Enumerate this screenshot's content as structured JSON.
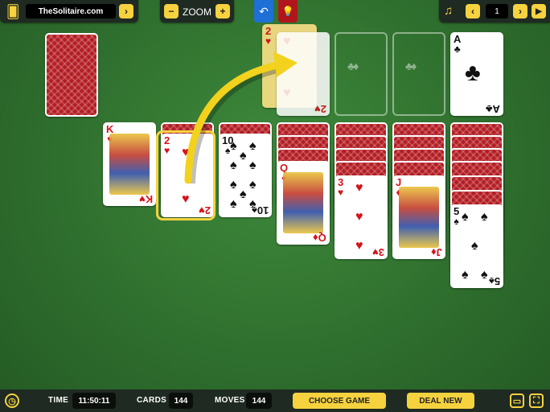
{
  "header": {
    "logo_text": "TheSolitaire.com",
    "forward_icon": "chevron-right-icon",
    "zoom_label": "ZOOM",
    "undo_icon": "undo-icon",
    "hint_icon": "lightbulb-icon",
    "music_icon": "music-icon",
    "page_number": "1"
  },
  "foundation": {
    "ace_rank": "A",
    "ace_suit": "♣",
    "empty_suits": "♣♦♥♠"
  },
  "hint_card": {
    "rank": "2",
    "suit": "♥"
  },
  "tableau": {
    "col1": {
      "rank": "K",
      "suit": "♥"
    },
    "col2": {
      "rank": "2",
      "suit": "♥"
    },
    "col3": {
      "rank": "10",
      "suit": "♠"
    },
    "col4": {
      "rank": "Q",
      "suit": "♦"
    },
    "col5": {
      "rank": "3",
      "suit": "♥"
    },
    "col6": {
      "rank": "J",
      "suit": "♦"
    },
    "col7": {
      "rank": "5",
      "suit": "♠"
    }
  },
  "status": {
    "time_label": "TIME",
    "time_value": "11:50:11",
    "cards_label": "CARDS",
    "cards_value": "144",
    "moves_label": "MOVES",
    "moves_value": "144",
    "choose_game": "CHOOSE GAME",
    "deal_new": "DEAL NEW"
  },
  "colors": {
    "felt": "#2f6f2e",
    "accent": "#f6d23f",
    "card_back": "#b31c22",
    "undo_blue": "#1e6fd6",
    "hint_red": "#b0161b"
  }
}
